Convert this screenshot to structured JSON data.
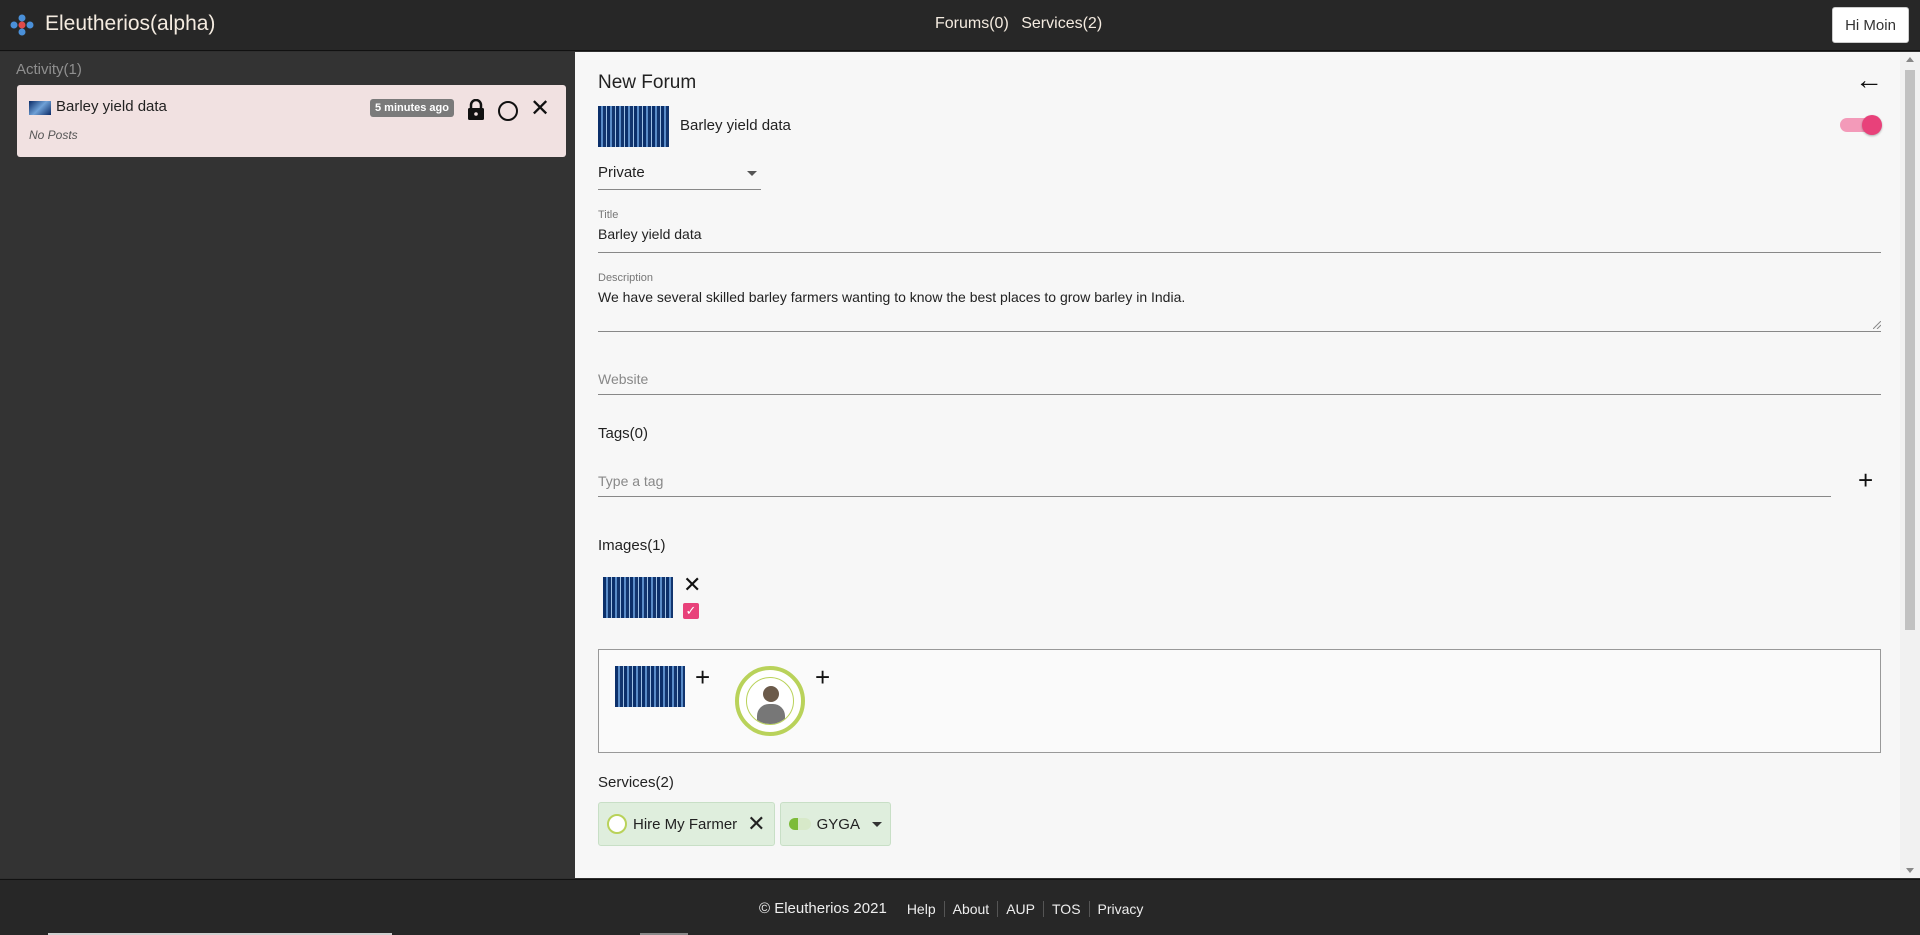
{
  "header": {
    "app_title": "Eleutherios(alpha)",
    "nav": [
      "Forums(0)",
      "Services(2)"
    ],
    "user_button": "Hi Moin"
  },
  "sidebar": {
    "activity_title": "Activity(1)",
    "card": {
      "title": "Barley yield data",
      "subtitle": "No Posts",
      "time_badge": "5 minutes ago"
    }
  },
  "form": {
    "heading": "New Forum",
    "forum_name": "Barley yield data",
    "visibility": "Private",
    "title_label": "Title",
    "title_value": "Barley yield data",
    "description_label": "Description",
    "description_value": "We have several skilled barley farmers wanting to know the best places to grow barley in India.",
    "website_placeholder": "Website",
    "tags_title": "Tags(0)",
    "tag_placeholder": "Type a tag",
    "images_title": "Images(1)",
    "services_title": "Services(2)",
    "services": [
      "Hire My Farmer",
      "GYGA"
    ],
    "enabled": true
  },
  "footer": {
    "copyright": "© Eleutherios 2021",
    "links": [
      "Help",
      "About",
      "AUP",
      "TOS",
      "Privacy"
    ]
  },
  "colors": {
    "accent": "#e8417a",
    "card_bg": "#f1e1e1",
    "chip_bg": "#dfeedd"
  }
}
